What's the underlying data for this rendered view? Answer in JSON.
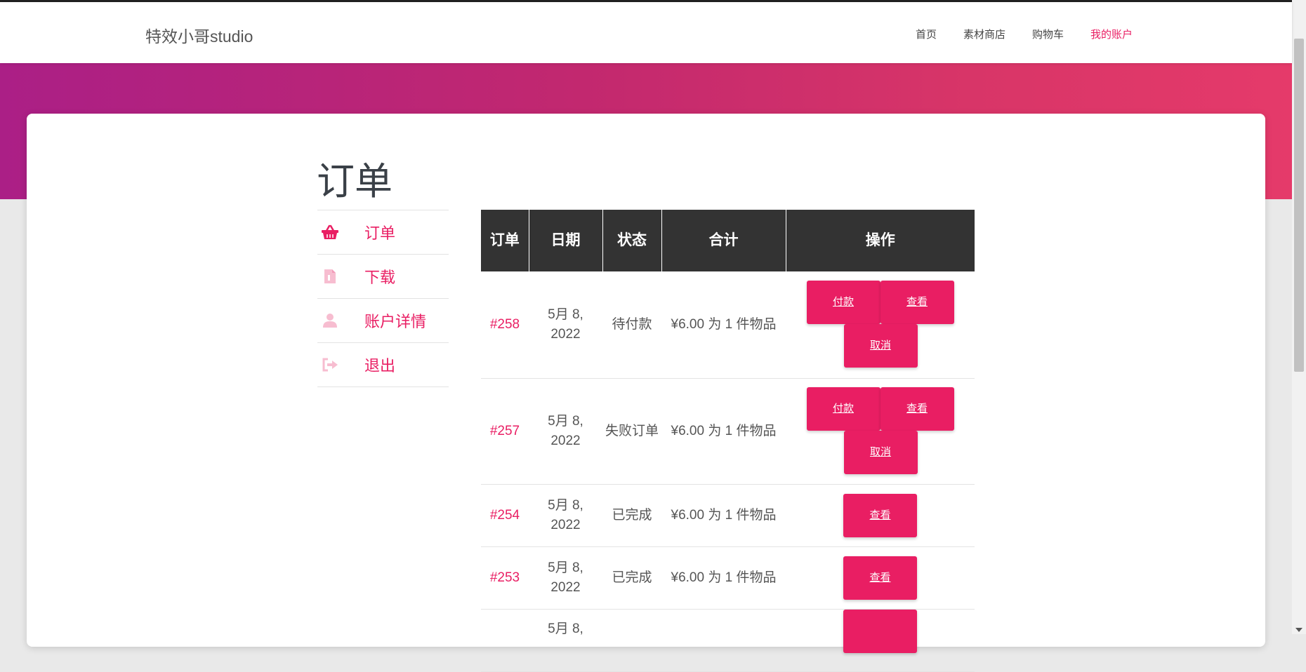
{
  "brand": "特效小哥studio",
  "nav": [
    {
      "label": "首页",
      "active": false
    },
    {
      "label": "素材商店",
      "active": false
    },
    {
      "label": "购物车",
      "active": false
    },
    {
      "label": "我的账户",
      "active": true
    }
  ],
  "page_title": "订单",
  "sidebar": [
    {
      "label": "订单",
      "icon": "basket-icon",
      "active": true
    },
    {
      "label": "下载",
      "icon": "file-icon",
      "active": false
    },
    {
      "label": "账户详情",
      "icon": "user-icon",
      "active": false
    },
    {
      "label": "退出",
      "icon": "sign-out-icon",
      "active": false
    }
  ],
  "table": {
    "headers": [
      "订单",
      "日期",
      "状态",
      "合计",
      "操作"
    ],
    "rows": [
      {
        "order": "#258",
        "date": "5月 8, 2022",
        "status": "待付款",
        "total": "¥6.00 为 1 件物品",
        "actions": [
          "付款",
          "查看",
          "取消"
        ]
      },
      {
        "order": "#257",
        "date": "5月 8, 2022",
        "status": "失败订单",
        "total": "¥6.00 为 1 件物品",
        "actions": [
          "付款",
          "查看",
          "取消"
        ]
      },
      {
        "order": "#254",
        "date": "5月 8, 2022",
        "status": "已完成",
        "total": "¥6.00 为 1 件物品",
        "actions": [
          "查看"
        ]
      },
      {
        "order": "#253",
        "date": "5月 8, 2022",
        "status": "已完成",
        "total": "¥6.00 为 1 件物品",
        "actions": [
          "查看"
        ]
      },
      {
        "order": "",
        "date": "5月 8,",
        "status": "",
        "total": "",
        "actions": [
          ""
        ]
      }
    ]
  },
  "colors": {
    "accent": "#e91e63",
    "header_bg": "#333333",
    "hero_start": "#ab1f86",
    "hero_end": "#e53a6a"
  }
}
